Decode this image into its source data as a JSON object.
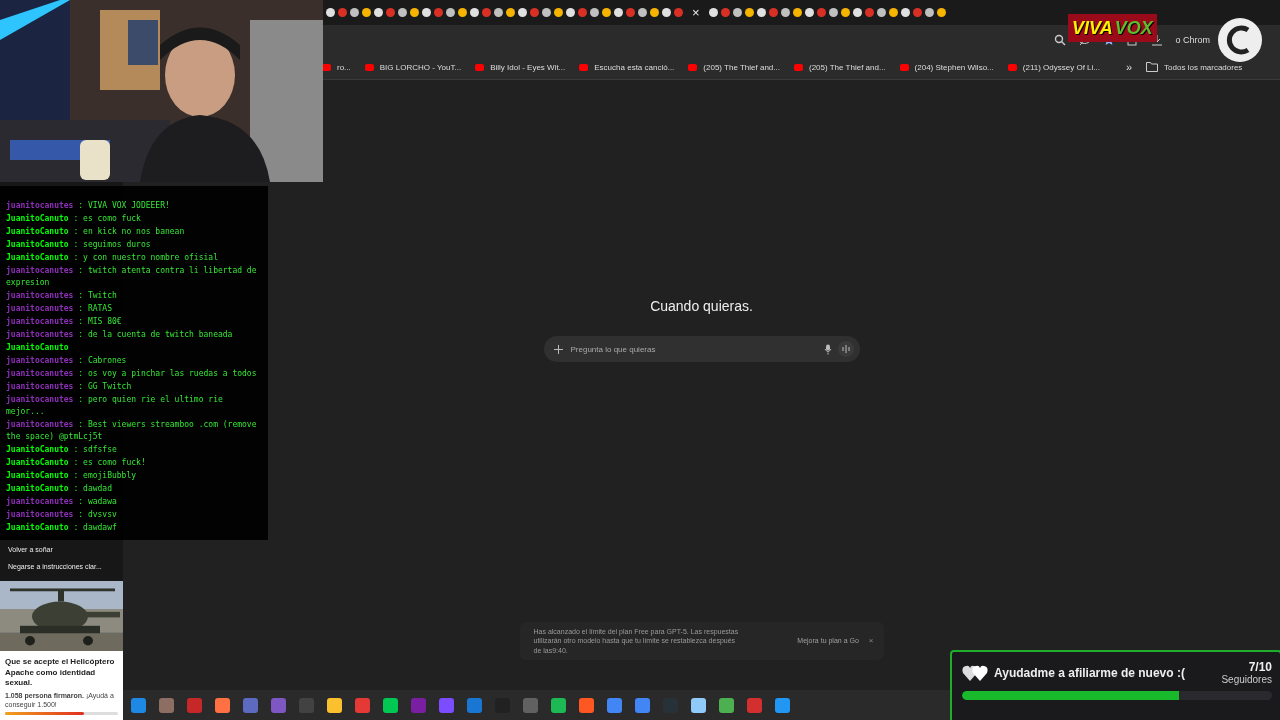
{
  "tab_close": "×",
  "logo": {
    "word_1": "VIVA",
    "word_2": "VOX"
  },
  "toolbar_text": "o Chrom",
  "bookmarks": [
    "ro...",
    "BIG LORCHO - YouT...",
    "Billy Idol - Eyes Wit...",
    "Escucha esta canció...",
    "(205) The Thief and...",
    "(205) The Thief and...",
    "(204) Stephen Wilso...",
    "(211) Odyssey Of Li..."
  ],
  "bookmarks_more": "»",
  "all_bookmarks": "Todos los marcadores",
  "chat": [
    {
      "user": "juanitocanutes",
      "color": "#8e2fb8",
      "text": ": VIVA VOX JODEEER!"
    },
    {
      "user": "JuanitoCanuto",
      "color": "#00ff00",
      "text": ": es como fuck"
    },
    {
      "user": "JuanitoCanuto",
      "color": "#00ff00",
      "text": ": en kick no nos banean"
    },
    {
      "user": "JuanitoCanuto",
      "color": "#00ff00",
      "text": ": seguimos duros"
    },
    {
      "user": "JuanitoCanuto",
      "color": "#00ff00",
      "text": ": y con nuestro nombre ofisial"
    },
    {
      "user": "juanitocanutes",
      "color": "#8e2fb8",
      "text": ": twitch atenta contra li libertad de expresion"
    },
    {
      "user": "juanitocanutes",
      "color": "#8e2fb8",
      "text": ": Twitch"
    },
    {
      "user": "juanitocanutes",
      "color": "#8e2fb8",
      "text": ": RATAS"
    },
    {
      "user": "juanitocanutes",
      "color": "#8e2fb8",
      "text": ": MIS 80€"
    },
    {
      "user": "juanitocanutes",
      "color": "#8e2fb8",
      "text": ": de la cuenta de twitch baneada"
    },
    {
      "user": "JuanitoCanuto",
      "color": "#00ff00"
    },
    {
      "user": "juanitocanutes",
      "color": "#8e2fb8",
      "text": ": Cabrones"
    },
    {
      "user": "juanitocanutes",
      "color": "#8e2fb8",
      "text": ": os voy a pinchar las ruedas a todos"
    },
    {
      "user": "juanitocanutes",
      "color": "#8e2fb8",
      "text": ": GG Twitch"
    },
    {
      "user": "juanitocanutes",
      "color": "#8e2fb8",
      "text": ": pero quien rie el ultimo rie mejor..."
    },
    {
      "user": "juanitocanutes",
      "color": "#8e2fb8",
      "text": ": Best viewers streamboo .com (remove the space) @ptmLcj5t"
    },
    {
      "user": "JuanitoCanuto",
      "color": "#00ff00",
      "text": ": sdfsfse"
    },
    {
      "user": "JuanitoCanuto",
      "color": "#00ff00",
      "text": ": es como fuck!"
    },
    {
      "user": "JuanitoCanuto",
      "color": "#00ff00",
      "text": ": emojiBubbly"
    },
    {
      "user": "JuanitoCanuto",
      "color": "#00ff00",
      "text": ": dawdad"
    },
    {
      "user": "juanitocanutes",
      "color": "#8e2fb8",
      "text": ": wadawa"
    },
    {
      "user": "juanitocanutes",
      "color": "#8e2fb8",
      "text": ": dvsvsv"
    },
    {
      "user": "JuanitoCanuto",
      "color": "#00ff00",
      "text": ": dawdawf"
    }
  ],
  "sidebar_items": [
    "Volver a soñar",
    "Negarse a instrucciones clar..."
  ],
  "petition": {
    "title": "Que se acepte el Helicóptero Apache como identidad sexual.",
    "signed": "**1.058 persona firmaron.** ¡Ayudá a conseguir 1.500!",
    "level": 0.7
  },
  "main": {
    "heading": "Cuando quieras.",
    "placeholder": "Pregunta lo que quieras"
  },
  "notice": {
    "text": "Has alcanzado el límite del plan Free para GPT-5. Las respuestas utilizarán otro modelo hasta que tu límite se restablezca después de las9:40.",
    "link": "Mejora tu plan a Go",
    "close": "×"
  },
  "goal": {
    "title": "Ayudadme a afiliarme de nuevo :(",
    "count": "7/10",
    "unit": "Seguidores",
    "level": 0.7
  }
}
